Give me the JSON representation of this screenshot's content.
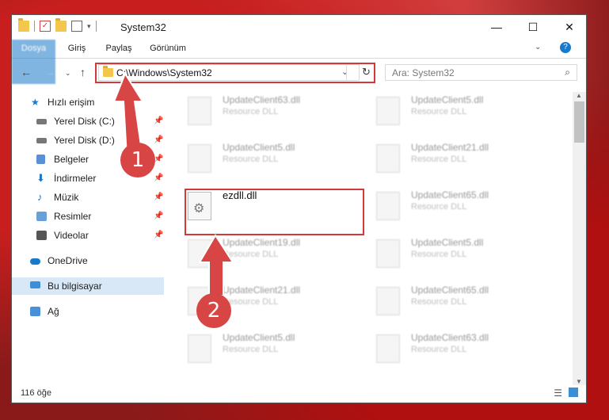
{
  "window": {
    "title": "System32",
    "min_icon": "minimize-icon",
    "max_icon": "maximize-icon",
    "close_icon": "close-icon"
  },
  "ribbon": {
    "tabs": [
      "Dosya",
      "Giriş",
      "Paylaş",
      "Görünüm"
    ]
  },
  "address": {
    "path": "C:\\Windows\\System32",
    "search_placeholder": "Ara: System32"
  },
  "sidebar": {
    "items": [
      {
        "label": "Hızlı erişim",
        "icon": "star-icon"
      },
      {
        "label": "Yerel Disk (C:)",
        "icon": "drive-icon",
        "pinned": true
      },
      {
        "label": "Yerel Disk (D:)",
        "icon": "drive-icon",
        "pinned": true
      },
      {
        "label": "Belgeler",
        "icon": "documents-icon",
        "pinned": true
      },
      {
        "label": "İndirmeler",
        "icon": "download-icon",
        "pinned": true
      },
      {
        "label": "Müzik",
        "icon": "music-icon",
        "pinned": true
      },
      {
        "label": "Resimler",
        "icon": "pictures-icon",
        "pinned": true
      },
      {
        "label": "Videolar",
        "icon": "videos-icon",
        "pinned": true
      },
      {
        "label": "OneDrive",
        "icon": "cloud-icon"
      },
      {
        "label": "Bu bilgisayar",
        "icon": "computer-icon",
        "selected": true
      },
      {
        "label": "Ağ",
        "icon": "network-icon"
      }
    ]
  },
  "files": [
    {
      "name": "UpdateClient63.dll",
      "type": "Resource DLL"
    },
    {
      "name": "UpdateClient5.dll",
      "type": "Resource DLL"
    },
    {
      "name": "UpdateClient5.dll",
      "type": "Resource DLL"
    },
    {
      "name": "UpdateClient21.dll",
      "type": "Resource DLL"
    },
    {
      "name": "ezdll.dll",
      "type": ""
    },
    {
      "name": "UpdateClient65.dll",
      "type": "Resource DLL"
    },
    {
      "name": "UpdateClient19.dll",
      "type": "Resource DLL"
    },
    {
      "name": "UpdateClient5.dll",
      "type": "Resource DLL"
    },
    {
      "name": "UpdateClient21.dll",
      "type": "Resource DLL"
    },
    {
      "name": "UpdateClient65.dll",
      "type": "Resource DLL"
    },
    {
      "name": "UpdateClient5.dll",
      "type": "Resource DLL"
    },
    {
      "name": "UpdateClient63.dll",
      "type": "Resource DLL"
    }
  ],
  "status": {
    "count": "116 öğe"
  },
  "annotations": {
    "step1": "1",
    "step2": "2",
    "highlight_color": "#d23a3a"
  }
}
